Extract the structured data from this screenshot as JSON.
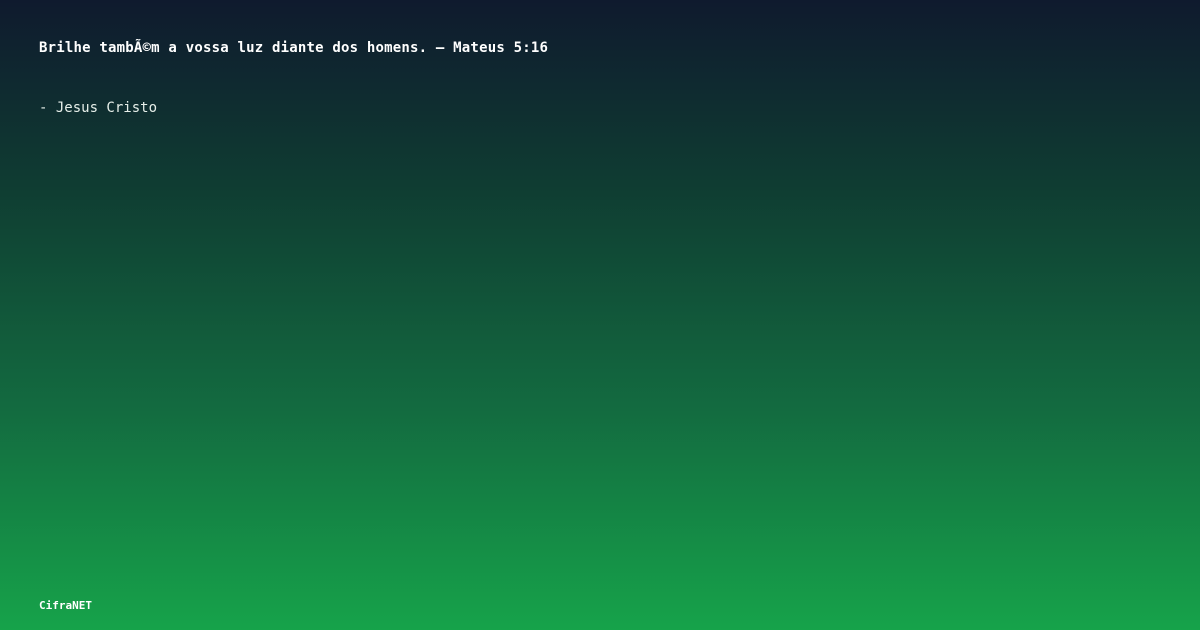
{
  "quote": {
    "text": "Brilhe tambÃ©m a vossa luz diante dos homens. – Mateus 5:16"
  },
  "author": {
    "text": "- Jesus Cristo"
  },
  "brand": {
    "name": "CifraNET"
  },
  "colors": {
    "gradient_top": "#0f1a2e",
    "gradient_bottom": "#16a34a",
    "text": "#ffffff"
  }
}
